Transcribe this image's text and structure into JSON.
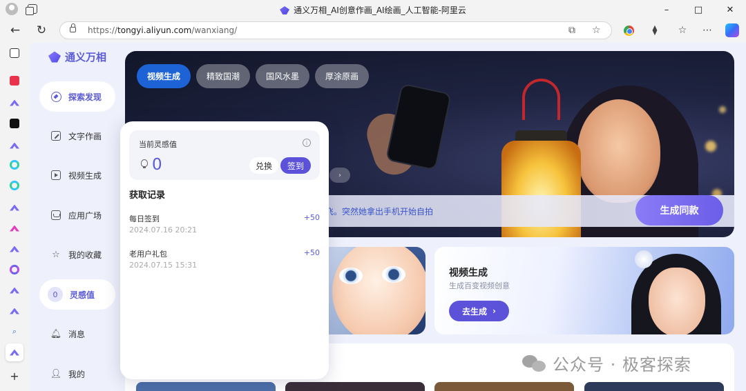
{
  "browser": {
    "tab_title": "通义万相_AI创意作画_AI绘画_人工智能-阿里云",
    "url_prefix": "https://",
    "url_host": "tongyi.aliyun.com",
    "url_path": "/wanxiang/",
    "window_controls": [
      "–",
      "□",
      "✕"
    ]
  },
  "app": {
    "brand": "通义万相",
    "accent": "#5b5bd6",
    "menu": [
      {
        "label": "探索发现",
        "icon": "compass-icon",
        "active": true
      },
      {
        "label": "文字作画",
        "icon": "edit-icon"
      },
      {
        "label": "视频生成",
        "icon": "play-icon"
      },
      {
        "label": "应用广场",
        "icon": "store-icon"
      },
      {
        "label": "我的收藏",
        "icon": "star-icon"
      },
      {
        "label": "灵感值",
        "icon": "badge",
        "badge": "0",
        "active": true
      },
      {
        "label": "消息",
        "icon": "bell-icon"
      },
      {
        "label": "我的",
        "icon": "user-icon"
      }
    ]
  },
  "banner": {
    "tags": [
      "视频生成",
      "精致国潮",
      "国风水墨",
      "厚涂原画"
    ],
    "prompt_text": "飞。突然她拿出手机开始自拍",
    "generate_label": "生成同款"
  },
  "video_card": {
    "title": "视频生成",
    "subtitle": "生成百变视频创意",
    "button": "去生成"
  },
  "popup": {
    "balance_label": "当前灵感值",
    "balance_value": "0",
    "exchange_label": "兑换",
    "checkin_label": "签到",
    "records_title": "获取记录",
    "records": [
      {
        "name": "每日签到",
        "date": "2024.07.16 20:21",
        "points": "+50"
      },
      {
        "name": "老用户礼包",
        "date": "2024.07.15 15:31",
        "points": "+50"
      }
    ]
  },
  "watermark": "公众号 · 极客探索"
}
